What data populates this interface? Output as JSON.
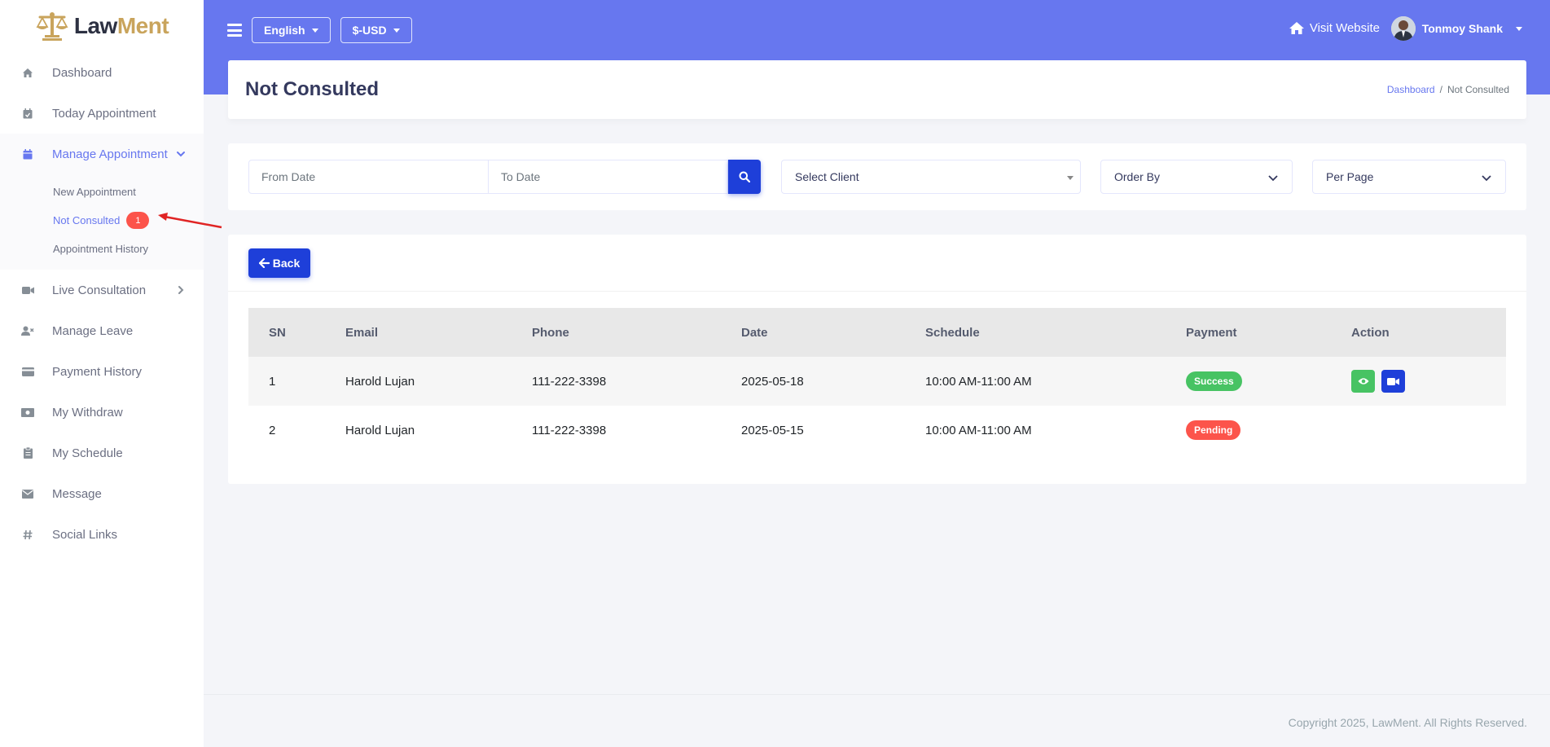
{
  "brand": {
    "name_part1": "Law",
    "name_part2": "Ment",
    "accent": "#c9a45c"
  },
  "sidebar": {
    "items": [
      {
        "label": "Dashboard",
        "icon": "home-icon"
      },
      {
        "label": "Today Appointment",
        "icon": "calendar-check-icon"
      },
      {
        "label": "Manage Appointment",
        "icon": "calendar-icon"
      },
      {
        "label": "Live Consultation",
        "icon": "video-icon"
      },
      {
        "label": "Manage Leave",
        "icon": "user-times-icon"
      },
      {
        "label": "Payment History",
        "icon": "credit-card-icon"
      },
      {
        "label": "My Withdraw",
        "icon": "money-bill-icon"
      },
      {
        "label": "My Schedule",
        "icon": "clipboard-icon"
      },
      {
        "label": "Message",
        "icon": "envelope-icon"
      },
      {
        "label": "Social Links",
        "icon": "hashtag-icon"
      }
    ],
    "submenu": [
      {
        "label": "New Appointment"
      },
      {
        "label": "Not Consulted",
        "badge": "1"
      },
      {
        "label": "Appointment History"
      }
    ]
  },
  "header": {
    "language": "English",
    "currency": "$-USD",
    "visit_website": "Visit Website",
    "user_name": "Tonmoy Shank",
    "accent": "#6777ef"
  },
  "page": {
    "title": "Not Consulted",
    "breadcrumb": {
      "home": "Dashboard",
      "current": "Not Consulted"
    }
  },
  "filters": {
    "from_date_placeholder": "From Date",
    "to_date_placeholder": "To Date",
    "client": "Select Client",
    "order_by": "Order By",
    "per_page": "Per Page"
  },
  "table": {
    "back_label": "Back",
    "columns": [
      "SN",
      "Email",
      "Phone",
      "Date",
      "Schedule",
      "Payment",
      "Action"
    ],
    "rows": [
      {
        "sn": "1",
        "email": "Harold Lujan",
        "phone": "111-222-3398",
        "date": "2025-05-18",
        "schedule": "10:00 AM-11:00 AM",
        "payment": "Success"
      },
      {
        "sn": "2",
        "email": "Harold Lujan",
        "phone": "111-222-3398",
        "date": "2025-05-15",
        "schedule": "10:00 AM-11:00 AM",
        "payment": "Pending"
      }
    ]
  },
  "footer": {
    "copyright": "Copyright 2025, LawMent. All Rights Reserved."
  }
}
